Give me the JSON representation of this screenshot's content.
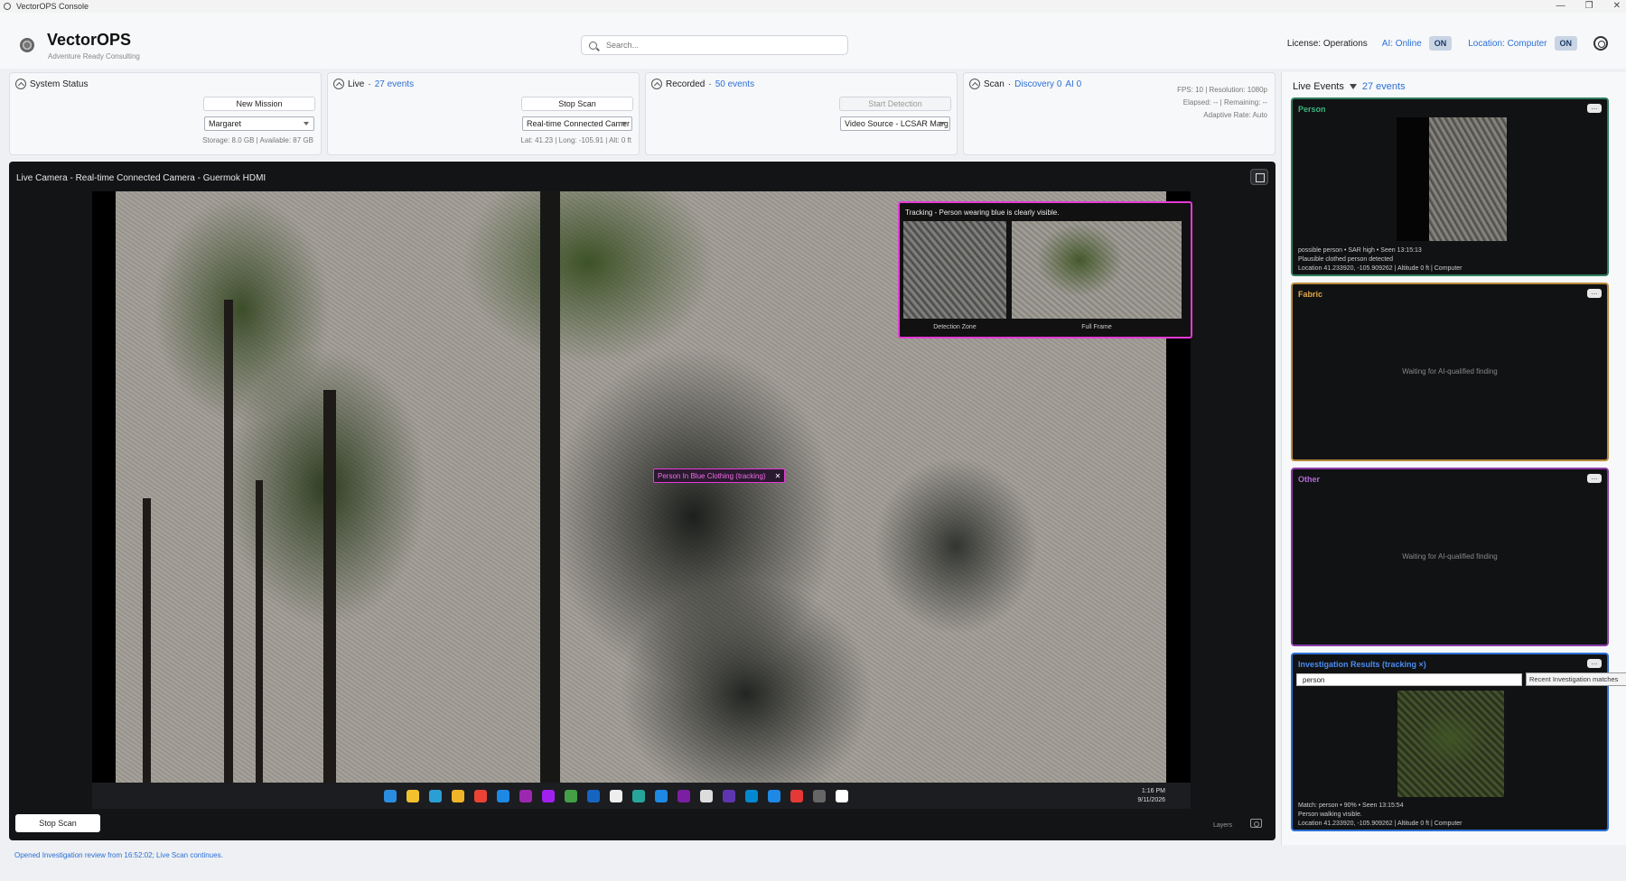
{
  "window": {
    "title": "VectorOPS Console",
    "controls": [
      "—",
      "❐",
      "✕"
    ]
  },
  "header": {
    "brand": "VectorOPS",
    "subtitle": "Adventure Ready Consulting",
    "search_placeholder": "Search...",
    "license": "License: Operations",
    "ai_status": "AI: Online",
    "ai_toggle": "ON",
    "location_label": "Location: Computer",
    "location_toggle": "ON"
  },
  "panels": {
    "system": {
      "title": "System Status",
      "new_mission": "New Mission",
      "mission_select": "Margaret",
      "storage": "Storage: 8.0 GB | Available: 87 GB"
    },
    "live": {
      "title": "Live",
      "events": "27 events",
      "stop_scan": "Stop Scan",
      "camera_select": "Real-time Connected Camer",
      "coords": "Lat: 41.23 | Long: -105.91 | Alt: 0 ft"
    },
    "recorded": {
      "title": "Recorded",
      "events": "50 events",
      "start_detection": "Start Detection",
      "source_select": "Video Source - LCSAR Marg"
    },
    "scan": {
      "title": "Scan",
      "discovery": "Discovery 0",
      "ai": "AI 0",
      "line1": "FPS: 10 | Resolution: 1080p",
      "line2": "Elapsed: -- | Remaining: --",
      "line3": "Adaptive Rate: Auto"
    }
  },
  "camera": {
    "title": "Live Camera - Real-time Connected Camera - Guermok HDMI",
    "popup_title": "Tracking - Person wearing blue is clearly visible.",
    "popup_cap1": "Detection Zone",
    "popup_cap2": "Full Frame",
    "detection_label": "Person In Blue Clothing (tracking)",
    "detection_close": "✕",
    "taskbar_time": "1:16 PM",
    "taskbar_date": "9/11/2026",
    "stop_scan": "Stop Scan",
    "layers": "Layers",
    "taskbar_icon_colors": [
      "#2b8de0",
      "#f2c12e",
      "#2a9fd6",
      "#f0b429",
      "#ea4335",
      "#1e88e5",
      "#9c27b0",
      "#a020f0",
      "#43a047",
      "#1565c0",
      "#eeeeee",
      "#26a69a",
      "#1e88e5",
      "#7b1fa2",
      "#dddddd",
      "#5e35b1",
      "#0288d1",
      "#1e88e5",
      "#e53935",
      "#666666",
      "#ffffff"
    ]
  },
  "status_line": "Opened Investigation review from 16:52:02; Live Scan continues.",
  "sidebar": {
    "title": "Live Events",
    "events": "27 events",
    "person": {
      "title": "Person",
      "menu": "...",
      "color": "#3fb37f",
      "info1": "possible person • SAR high • Seen 13:15:13",
      "info2": "Plausible clothed person detected",
      "info3": "Location 41.233920, -105.909262 | Altitude 0 ft | Computer"
    },
    "fabric": {
      "title": "Fabric",
      "menu": "...",
      "color": "#e0a84a",
      "waiting": "Waiting for AI-qualified finding"
    },
    "other": {
      "title": "Other",
      "menu": "...",
      "color": "#b36ad6",
      "waiting": "Waiting for AI-qualified finding"
    },
    "investigation": {
      "title": "Investigation Results (tracking ×)",
      "menu": "...",
      "color": "#4a8cf0",
      "query": "person",
      "tooltip": "Recent Investigation matches",
      "info1": "Match: person • 90% • Seen 13:15:54",
      "info2": "Person walking visible.",
      "info3": "Location 41.233920, -105.909262 | Altitude 0 ft | Computer"
    }
  }
}
